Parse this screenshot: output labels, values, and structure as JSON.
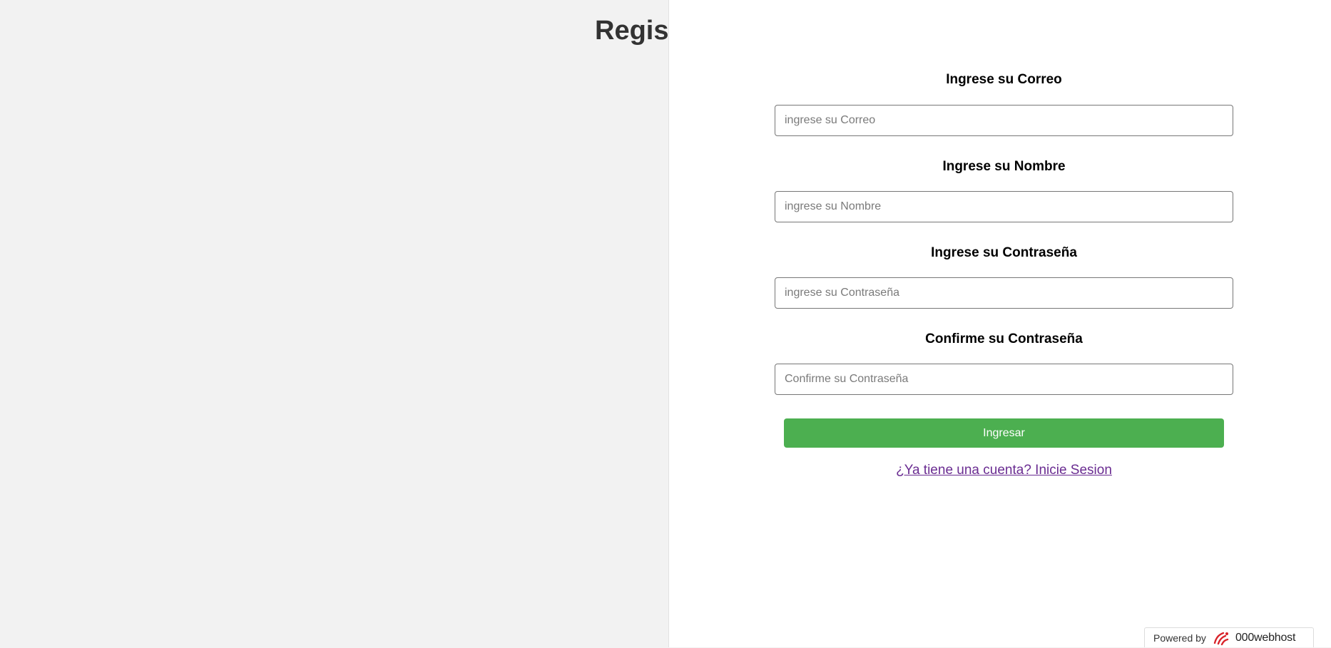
{
  "page": {
    "title": "Regis"
  },
  "form": {
    "email": {
      "label": "Ingrese su Correo",
      "placeholder": "ingrese su Correo",
      "value": ""
    },
    "name": {
      "label": "Ingrese su Nombre",
      "placeholder": "ingrese su Nombre",
      "value": ""
    },
    "password": {
      "label": "Ingrese su Contraseña",
      "placeholder": "ingrese su Contraseña",
      "value": ""
    },
    "confirm_password": {
      "label": "Confirme su Contraseña",
      "placeholder": "Confirme su Contraseña",
      "value": ""
    },
    "submit_label": "Ingresar",
    "login_link_text": "¿Ya tiene una cuenta? Inicie Sesion"
  },
  "footer": {
    "powered_by": "Powered by",
    "host_name": "000webhost",
    "logo_icon": "000webhost-logo-icon"
  },
  "colors": {
    "background": "#f2f2f2",
    "panel": "#ffffff",
    "submit_button": "#4caf50",
    "link": "#6a2c91",
    "logo_red": "#d8232a"
  }
}
